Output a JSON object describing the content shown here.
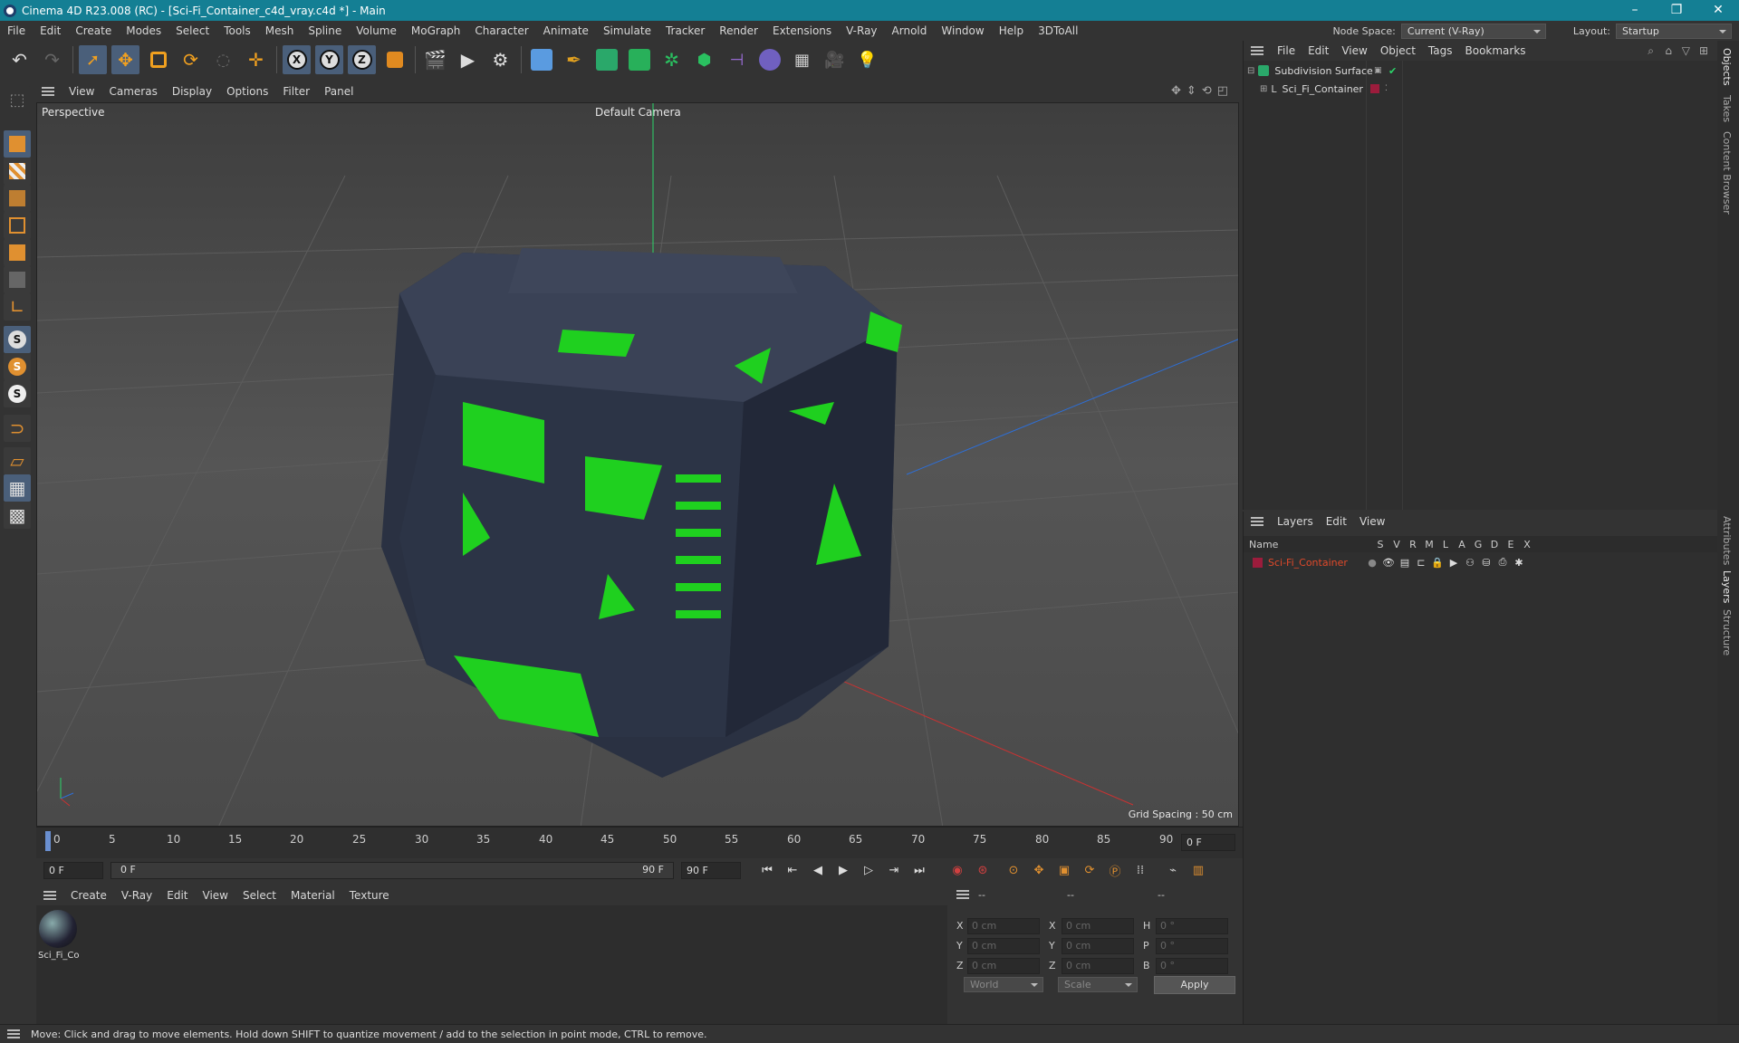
{
  "window": {
    "title": "Cinema 4D R23.008 (RC) - [Sci-Fi_Container_c4d_vray.c4d *] - Main",
    "min": "–",
    "max": "❐",
    "close": "✕"
  },
  "menu": [
    "File",
    "Edit",
    "Create",
    "Modes",
    "Select",
    "Tools",
    "Mesh",
    "Spline",
    "Volume",
    "MoGraph",
    "Character",
    "Animate",
    "Simulate",
    "Tracker",
    "Render",
    "Extensions",
    "V-Ray",
    "Arnold",
    "Window",
    "Help",
    "3DToAll"
  ],
  "nodespace": {
    "label": "Node Space:",
    "value": "Current (V-Ray)"
  },
  "layout": {
    "label": "Layout:",
    "value": "Startup"
  },
  "viewport_menu": [
    "View",
    "Cameras",
    "Display",
    "Options",
    "Filter",
    "Panel"
  ],
  "viewport": {
    "label": "Perspective",
    "camera": "Default Camera",
    "grid_spacing": "Grid Spacing : 50 cm"
  },
  "timeline": {
    "ticks": [
      "0",
      "5",
      "10",
      "15",
      "20",
      "25",
      "30",
      "35",
      "40",
      "45",
      "50",
      "55",
      "60",
      "65",
      "70",
      "75",
      "80",
      "85",
      "90"
    ],
    "current": "0 F",
    "start": "0 F",
    "range_start": "0 F",
    "range_end": "90 F",
    "end": "90 F"
  },
  "material_menu": [
    "Create",
    "V-Ray",
    "Edit",
    "View",
    "Select",
    "Material",
    "Texture"
  ],
  "material": {
    "name": "Sci_Fi_Co"
  },
  "coords": {
    "header": [
      "--",
      "--",
      "--"
    ],
    "rows": [
      {
        "a": "X",
        "av": "0 cm",
        "b": "X",
        "bv": "0 cm",
        "c": "H",
        "cv": "0 °"
      },
      {
        "a": "Y",
        "av": "0 cm",
        "b": "Y",
        "bv": "0 cm",
        "c": "P",
        "cv": "0 °"
      },
      {
        "a": "Z",
        "av": "0 cm",
        "b": "Z",
        "bv": "0 cm",
        "c": "B",
        "cv": "0 °"
      }
    ],
    "world": "World",
    "scale": "Scale",
    "apply": "Apply"
  },
  "objects_menu": [
    "File",
    "Edit",
    "View",
    "Object",
    "Tags",
    "Bookmarks"
  ],
  "objects": [
    {
      "name": "Subdivision Surface"
    },
    {
      "name": "Sci_Fi_Container"
    }
  ],
  "layers_menu": [
    "Layers",
    "Edit",
    "View"
  ],
  "layers_header": {
    "name": "Name",
    "cols": [
      "S",
      "V",
      "R",
      "M",
      "L",
      "A",
      "G",
      "D",
      "E",
      "X"
    ]
  },
  "layers": [
    {
      "name": "Sci-Fi_Container"
    }
  ],
  "right_tabs": [
    "Objects",
    "Takes",
    "Content Browser",
    "Attributes",
    "Layers",
    "Structure"
  ],
  "status": "Move: Click and drag to move elements. Hold down SHIFT to quantize movement / add to the selection in point mode, CTRL to remove.",
  "colors": {
    "titlebar": "#147f94",
    "accent_green": "#1fd01f",
    "layer_red": "#e0492a"
  }
}
